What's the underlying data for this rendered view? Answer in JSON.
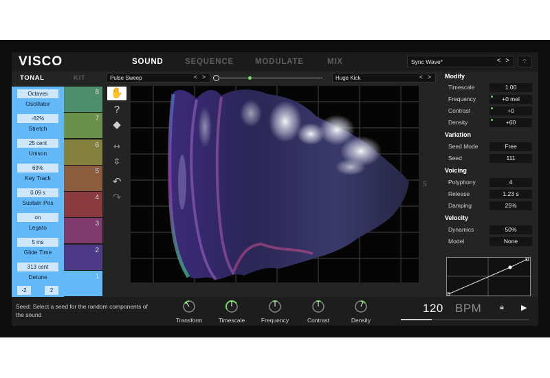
{
  "header": {
    "logo": "VISCO",
    "tabs": [
      {
        "label": "SOUND",
        "active": true
      },
      {
        "label": "SEQUENCE",
        "active": false
      },
      {
        "label": "MODULATE",
        "active": false
      },
      {
        "label": "MIX",
        "active": false
      }
    ],
    "preset": "Sync Wave*",
    "preset_arrows": "< >",
    "icon": "dice-icon"
  },
  "left": {
    "tabs": [
      {
        "label": "TONAL",
        "active": true
      },
      {
        "label": "KIT",
        "active": false
      }
    ],
    "params": {
      "octaves_label": "Octaves",
      "oscillator_label": "Oscillator",
      "stretch_value": "-62%",
      "stretch_label": "Stretch",
      "unison_value": "25 cent",
      "unison_label": "Unison",
      "keytrack_value": "69%",
      "keytrack_label": "Key Track",
      "sustainpos_value": "0.09 s",
      "sustainpos_label": "Sustain Pos",
      "legato_value": "on",
      "legato_label": "Legato",
      "glide_value": "5 ms",
      "glide_label": "Glide Time",
      "detune_value": "313 cent",
      "detune_label": "Detune",
      "range_low": "-2",
      "range_high": "2"
    },
    "steps": [
      {
        "num": "8",
        "color": "#4f8e6c"
      },
      {
        "num": "7",
        "color": "#6b8f4d"
      },
      {
        "num": "6",
        "color": "#84803f"
      },
      {
        "num": "5",
        "color": "#8b5d3e"
      },
      {
        "num": "4",
        "color": "#8a3b3f"
      },
      {
        "num": "3",
        "color": "#7d3a6a"
      },
      {
        "num": "2",
        "color": "#4d3a86"
      },
      {
        "num": "1",
        "color": "#63b8f7"
      }
    ]
  },
  "center": {
    "left_select": "Pulse Sweep",
    "right_select": "Huge Kick",
    "select_arrows": "< >",
    "slider_position": 0.3,
    "axis_label": "S",
    "tools": [
      "brush-icon",
      "random-icon",
      "eraser-icon",
      "stretch-horizontal-icon",
      "stretch-vertical-icon",
      "undo-icon",
      "redo-icon"
    ]
  },
  "right": {
    "modify_title": "Modify",
    "timescale_label": "Timescale",
    "timescale_value": "1.00",
    "frequency_label": "Frequency",
    "frequency_value": "+0 mel",
    "contrast_label": "Contrast",
    "contrast_value": "+0",
    "density_label": "Density",
    "density_value": "+60",
    "variation_title": "Variation",
    "seedmode_label": "Seed Mode",
    "seedmode_value": "Free",
    "seed_label": "Seed",
    "seed_value": "111",
    "voicing_title": "Voicing",
    "polyphony_label": "Polyphony",
    "polyphony_value": "4",
    "release_label": "Release",
    "release_value": "1.23 s",
    "damping_label": "Damping",
    "damping_value": "25%",
    "velocity_title": "Velocity",
    "dynamics_label": "Dynamics",
    "dynamics_value": "50%",
    "model_label": "Model",
    "model_value": "None"
  },
  "footer": {
    "help_text": "Seed: Select a seed for the random components of the sound",
    "knobs": [
      "Transform",
      "Timescale",
      "Frequency",
      "Contrast",
      "Density"
    ],
    "bpm_value": "120",
    "bpm_unit": "BPM",
    "progress": 0.24,
    "accent_color": "#6ee05a"
  }
}
